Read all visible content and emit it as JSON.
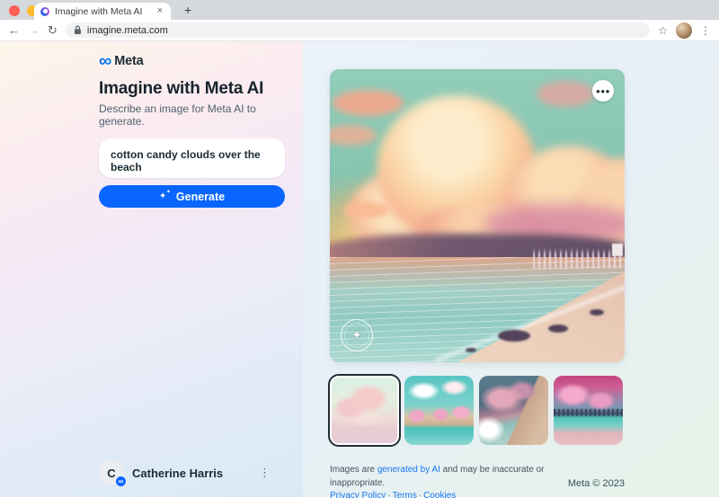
{
  "browser": {
    "tab": {
      "title": "Imagine with Meta AI",
      "close_glyph": "×",
      "new_tab_glyph": "+"
    },
    "toolbar": {
      "back_glyph": "←",
      "forward_glyph": "→",
      "reload_glyph": "↻",
      "url": "imagine.meta.com",
      "star_glyph": "☆",
      "menu_glyph": "⋮"
    }
  },
  "sidebar": {
    "brand": "Meta",
    "brand_glyph": "∞",
    "title": "Imagine with Meta AI",
    "subtitle": "Describe an image for Meta AI to generate.",
    "prompt": {
      "value": "cotton candy clouds over the beach"
    },
    "generate": {
      "label": "Generate",
      "icon_glyph": "✦"
    },
    "profile": {
      "name": "Catherine Harris",
      "initial": "C",
      "badge_glyph": "∞",
      "menu_glyph": "⋮"
    }
  },
  "canvas": {
    "more_glyph": "●●●",
    "watermark_glyph": "✦",
    "thumbnails": {
      "count": 4,
      "selected_index": 0
    }
  },
  "footer": {
    "disclaimer_prefix": "Images are ",
    "disclaimer_link": "generated by AI",
    "disclaimer_suffix": " and may be inaccurate or inappropriate.",
    "links": [
      "Privacy Policy",
      "Terms",
      "Cookies"
    ],
    "separator": "·",
    "copyright": "Meta © 2023"
  },
  "colors": {
    "accent": "#0866ff",
    "link": "#1877f2",
    "brand_blue": "#0080fb"
  }
}
